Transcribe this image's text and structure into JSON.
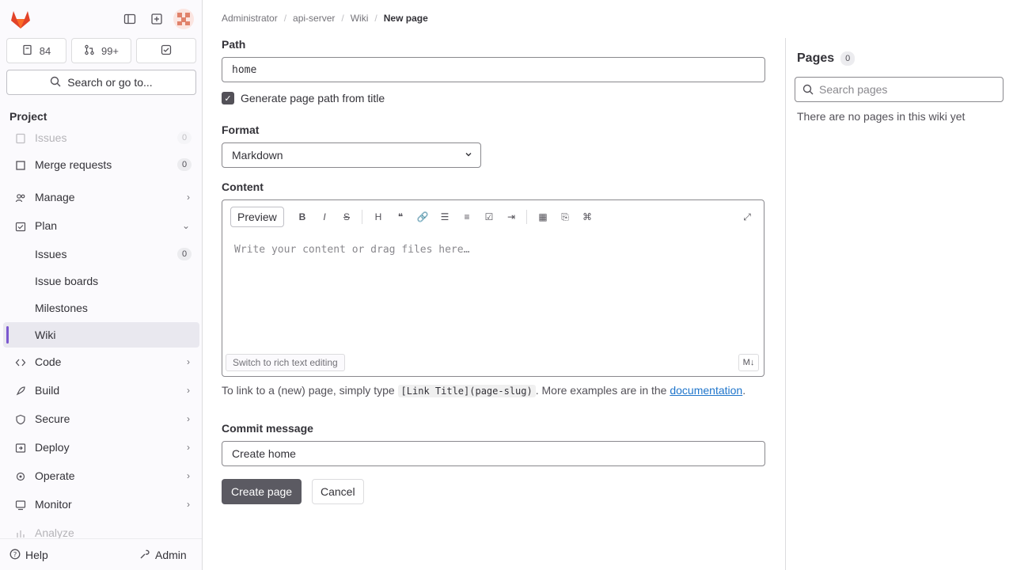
{
  "sidebar": {
    "counters": [
      {
        "icon": "issues-icon",
        "value": "84"
      },
      {
        "icon": "merge-request-icon",
        "value": "99+"
      },
      {
        "icon": "todo-icon",
        "value": ""
      }
    ],
    "search_label": "Search or go to...",
    "section_label": "Project",
    "items": [
      {
        "label": "Issues",
        "count": "0"
      },
      {
        "label": "Merge requests",
        "count": "0"
      },
      {
        "label": "Manage"
      },
      {
        "label": "Plan"
      },
      {
        "label": "Issues",
        "count": "0"
      },
      {
        "label": "Issue boards"
      },
      {
        "label": "Milestones"
      },
      {
        "label": "Wiki"
      },
      {
        "label": "Code"
      },
      {
        "label": "Build"
      },
      {
        "label": "Secure"
      },
      {
        "label": "Deploy"
      },
      {
        "label": "Operate"
      },
      {
        "label": "Monitor"
      },
      {
        "label": "Analyze"
      }
    ],
    "help_label": "Help",
    "admin_label": "Admin"
  },
  "breadcrumb": [
    "Administrator",
    "api-server",
    "Wiki",
    "New page"
  ],
  "form": {
    "path_label": "Path",
    "path_value": "home",
    "generate_path_label": "Generate page path from title",
    "format_label": "Format",
    "format_value": "Markdown",
    "content_label": "Content",
    "preview_label": "Preview",
    "content_placeholder": "Write your content or drag files here…",
    "switch_label": "Switch to rich text editing",
    "help_prefix": "To link to a (new) page, simply type",
    "help_code": "[Link Title](page-slug)",
    "help_middle": ". More examples are in the",
    "help_link": "documentation",
    "commit_label": "Commit message",
    "commit_value": "Create home",
    "create_label": "Create page",
    "cancel_label": "Cancel"
  },
  "pages_panel": {
    "title": "Pages",
    "count": "0",
    "search_placeholder": "Search pages",
    "empty_text": "There are no pages in this wiki yet"
  },
  "colors": {
    "brand": "#7b58cf",
    "primary_button": "#5b5a62",
    "link": "#1f75cb"
  }
}
